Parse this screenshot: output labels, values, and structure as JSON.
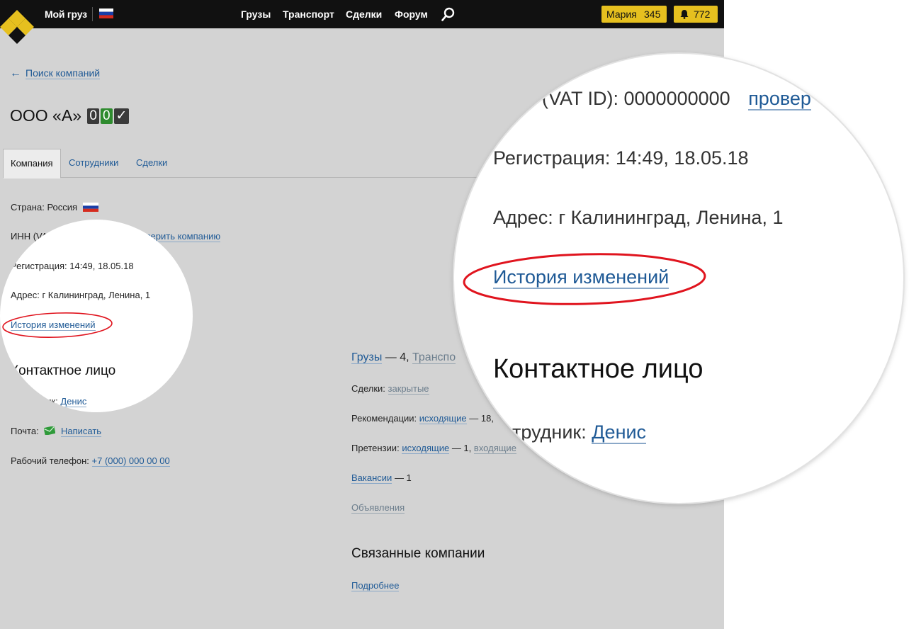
{
  "topbar": {
    "my_cargo": "Мой груз",
    "nav": [
      "Грузы",
      "Транспорт",
      "Сделки",
      "Форум"
    ],
    "user_name": "Мария",
    "user_score": "345",
    "notifications": "772"
  },
  "back_link": "Поиск компаний",
  "company": {
    "name": "ООО «А»",
    "badge_a": "0",
    "badge_b": "0",
    "badge_check": "✓"
  },
  "tabs": [
    "Компания",
    "Сотрудники",
    "Сделки"
  ],
  "details": {
    "country_label": "Страна:",
    "country_value": "Россия",
    "inn_label": "ИНН (VAT ID):",
    "inn_value": "0000000000",
    "verify_link": "проверить компанию",
    "reg_label": "Регистрация:",
    "reg_value": "14:49, 18.05.18",
    "addr_label": "Адрес:",
    "addr_value": "г Калининград, Ленина, 1",
    "history_link": "История изменений"
  },
  "contact": {
    "heading": "Контактное лицо",
    "employee_label": "Сотрудник:",
    "employee_value": "Денис",
    "mail_label": "Почта:",
    "mail_link": "Написать",
    "phone_label": "Рабочий телефон:",
    "phone_value": "+7 (000) 000 00 00"
  },
  "stats": {
    "cargo_link": "Грузы",
    "cargo_count": "— 4,",
    "transport_link": "Транспо",
    "deals_label": "Сделки:",
    "deals_link": "закрытые",
    "rec_label": "Рекомендации:",
    "rec_link": "исходящие",
    "rec_count": "— 18,",
    "claims_label": "Претензии:",
    "claims_out_link": "исходящие",
    "claims_out_count": "— 1,",
    "claims_in_link": "входящие",
    "vacancies_link": "Вакансии",
    "vacancies_count": "— 1",
    "ads_link": "Объявления"
  },
  "related": {
    "heading": "Связанные компании",
    "more_link": "Подробнее"
  },
  "zoom": {
    "inn_partial": "(VAT ID): 0000000000",
    "verify_partial": "провер",
    "employee_partial": "трудник:"
  },
  "colors": {
    "accent_yellow": "#e6c01f",
    "link_blue": "#1f5a96",
    "annotation_red": "#e0141e",
    "badge_green": "#2e8b2e"
  }
}
